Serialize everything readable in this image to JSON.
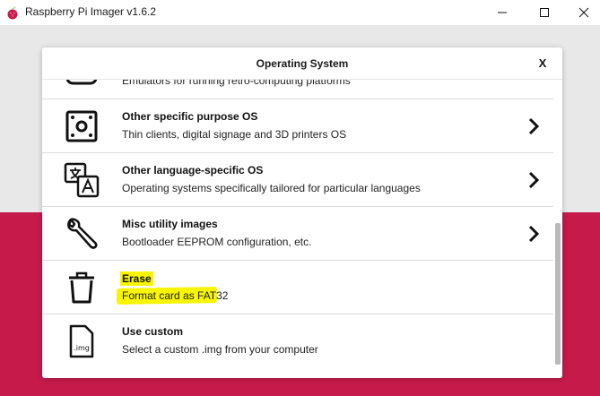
{
  "window": {
    "title": "Raspberry Pi Imager v1.6.2",
    "controls": {
      "minimize": "—",
      "maximize": "☐",
      "close": "✕"
    }
  },
  "dialog": {
    "title": "Operating System",
    "close_label": "X",
    "items": [
      {
        "title": "",
        "description": "Emulators for running retro-computing platforms",
        "icon": "gamepad-icon",
        "has_chevron": false
      },
      {
        "title": "Other specific purpose OS",
        "description": "Thin clients, digital signage and 3D printers OS",
        "icon": "dice-icon",
        "has_chevron": true
      },
      {
        "title": "Other language-specific OS",
        "description": "Operating systems specifically tailored for particular languages",
        "icon": "translate-icon",
        "has_chevron": true
      },
      {
        "title": "Misc utility images",
        "description": "Bootloader EEPROM configuration, etc.",
        "icon": "wrench-icon",
        "has_chevron": true
      },
      {
        "title": "Erase",
        "description": "Format card as FAT32",
        "icon": "trash-icon",
        "has_chevron": false
      },
      {
        "title": "Use custom",
        "description": "Select a custom .img from your computer",
        "icon": "img-file-icon",
        "icon_text": ".img",
        "has_chevron": false
      }
    ]
  },
  "colors": {
    "accent": "#c51a4a",
    "highlight": "#f8f500"
  }
}
